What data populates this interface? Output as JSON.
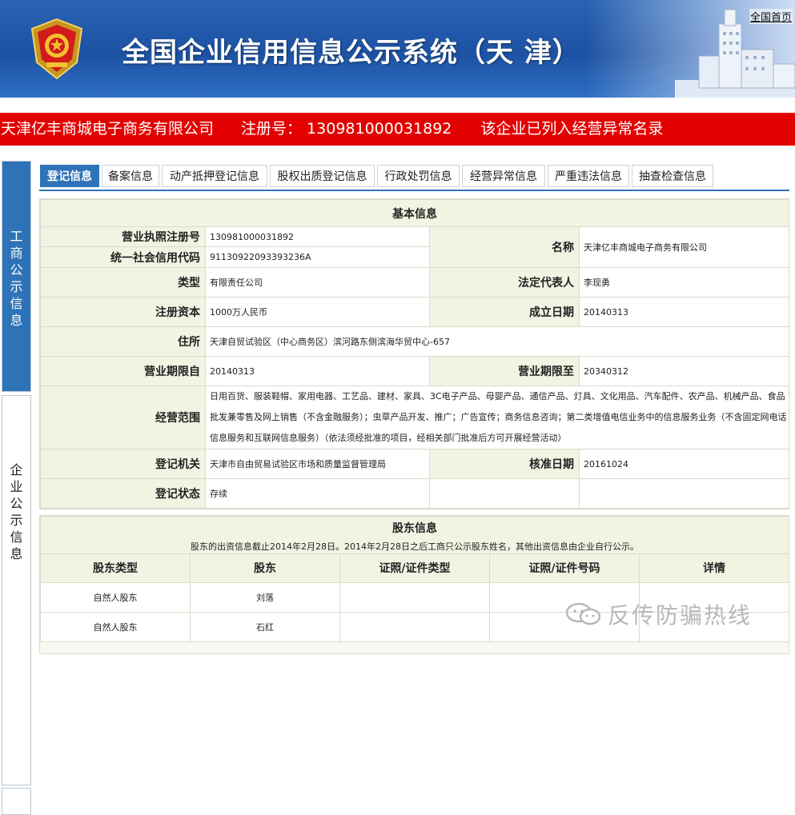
{
  "header": {
    "title": "全国企业信用信息公示系统（天 津）",
    "home_link": "全国首页"
  },
  "alert": {
    "company": "天津亿丰商城电子商务有限公司",
    "reg_no": "注册号： 130981000031892",
    "abnormal": "该企业已列入经营异常名录"
  },
  "side_nav": [
    {
      "label": "工商公示信息",
      "active": true
    },
    {
      "label": "企业公示信息",
      "active": false
    }
  ],
  "tabs": [
    {
      "label": "登记信息",
      "active": true
    },
    {
      "label": "备案信息"
    },
    {
      "label": "动产抵押登记信息"
    },
    {
      "label": "股权出质登记信息"
    },
    {
      "label": "行政处罚信息"
    },
    {
      "label": "经营异常信息"
    },
    {
      "label": "严重违法信息"
    },
    {
      "label": "抽查检查信息"
    }
  ],
  "basic": {
    "caption": "基本信息",
    "reg_no_label": "营业执照注册号",
    "reg_no": "130981000031892",
    "credit_code_label": "统一社会信用代码",
    "credit_code": "91130922093393236A",
    "name_label": "名称",
    "name": "天津亿丰商城电子商务有限公司",
    "type_label": "类型",
    "type": "有限责任公司",
    "rep_label": "法定代表人",
    "rep": "李现勇",
    "capital_label": "注册资本",
    "capital": "1000万人民币",
    "established_label": "成立日期",
    "established": "20140313",
    "address_label": "住所",
    "address": "天津自贸试验区（中心商务区）滨河路东侧滨海华贸中心-657",
    "term_from_label": "营业期限自",
    "term_from": "20140313",
    "term_to_label": "营业期限至",
    "term_to": "20340312",
    "scope_label": "经营范围",
    "scope": "日用百货、服装鞋帽、家用电器、工艺品、建材、家具、3C电子产品、母婴产品、通信产品、灯具、文化用品、汽车配件、农产品、机械产品、食品批发兼零售及网上销售（不含金融服务）；虫草产品开发、推广；广告宣传；商务信息咨询；第二类增值电信业务中的信息服务业务（不含固定网电话信息服务和互联网信息服务）（依法须经批准的项目，经相关部门批准后方可开展经营活动）",
    "authority_label": "登记机关",
    "authority": "天津市自由贸易试验区市场和质量监督管理局",
    "approved_label": "核准日期",
    "approved": "20161024",
    "status_label": "登记状态",
    "status": "存续"
  },
  "shareholders": {
    "caption": "股东信息",
    "note": "股东的出资信息截止2014年2月28日。2014年2月28日之后工商只公示股东姓名，其他出资信息由企业自行公示。",
    "columns": [
      "股东类型",
      "股东",
      "证照/证件类型",
      "证照/证件号码",
      "详情"
    ],
    "rows": [
      [
        "自然人股东",
        "刘落",
        "",
        "",
        ""
      ],
      [
        "自然人股东",
        "石红",
        "",
        "",
        ""
      ]
    ]
  },
  "watermark": {
    "text": "反传防骗热线"
  },
  "colors": {
    "banner_blue": "#1d52a3",
    "alert_red": "#e30000",
    "tab_active": "#2e73b8",
    "label_bg": "#f3f3e4"
  }
}
